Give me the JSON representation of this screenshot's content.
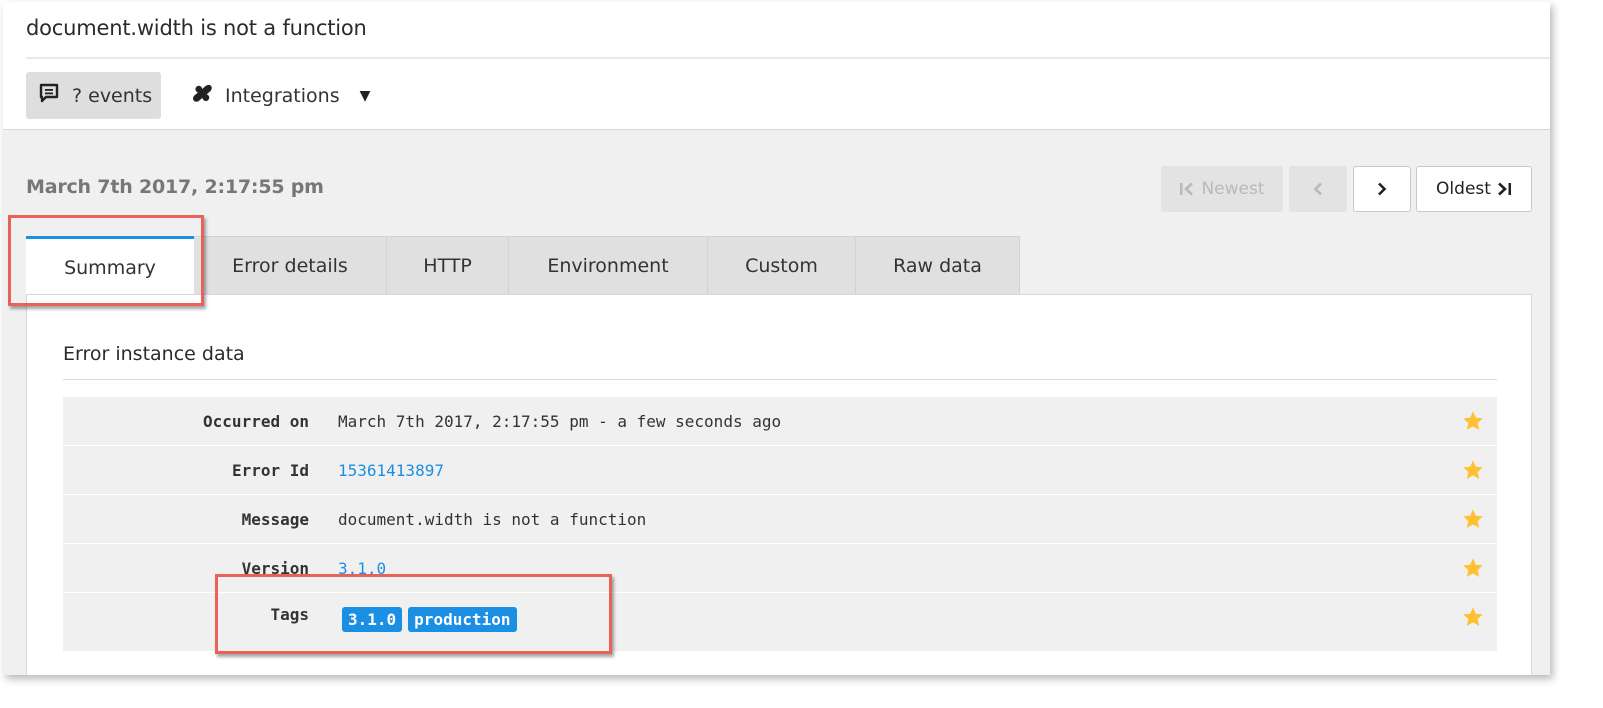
{
  "header": {
    "title": "document.width is not a function",
    "events_button": {
      "icon": "comment-icon",
      "label": "? events"
    },
    "integrations_button": {
      "icon": "puzzle-icon",
      "label": "Integrations",
      "caret": "▼"
    }
  },
  "event": {
    "date": "March 7th 2017, 2:17:55 pm"
  },
  "pager": {
    "newest": {
      "label": "Newest",
      "enabled": false
    },
    "previous": {
      "enabled": false
    },
    "next": {
      "enabled": true
    },
    "oldest": {
      "label": "Oldest",
      "enabled": true
    }
  },
  "tabs": [
    {
      "label": "Summary",
      "active": true
    },
    {
      "label": "Error details",
      "active": false
    },
    {
      "label": "HTTP",
      "active": false
    },
    {
      "label": "Environment",
      "active": false
    },
    {
      "label": "Custom",
      "active": false
    },
    {
      "label": "Raw data",
      "active": false
    }
  ],
  "summary": {
    "section_title": "Error instance data",
    "rows": [
      {
        "label": "Occurred on",
        "value": "March 7th 2017, 2:17:55 pm - a few seconds ago"
      },
      {
        "label": "Error Id",
        "value": "15361413897"
      },
      {
        "label": "Message",
        "value": "document.width is not a function"
      },
      {
        "label": "Version",
        "value": "3.1.0"
      },
      {
        "label": "Tags",
        "tags": [
          "3.1.0",
          "production"
        ]
      }
    ]
  },
  "colors": {
    "accent": "#1a8fe3",
    "star": "#ffc131",
    "annotation": "#e8625a"
  }
}
